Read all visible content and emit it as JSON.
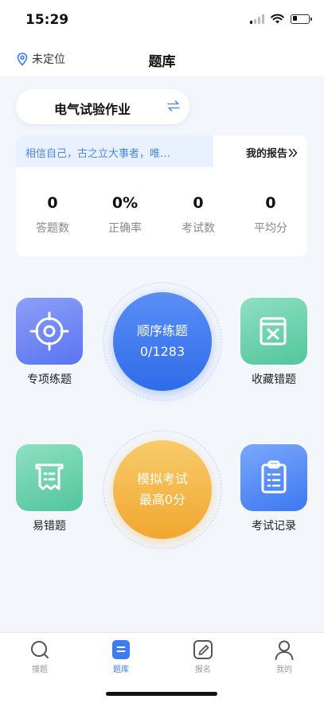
{
  "status_bar": {
    "time": "15:29",
    "battery_level": 0.3
  },
  "nav": {
    "location": "未定位",
    "title": "题库"
  },
  "subject": {
    "name": "电气试验作业",
    "switch_icon": "swap-arrows-icon"
  },
  "stats_card": {
    "motto": "相信自己，古之立大事者，唯…",
    "report_label": "我的报告",
    "report_icon": "double-chevron-right-icon",
    "stats": [
      {
        "value": "0",
        "label": "答题数"
      },
      {
        "value": "0%",
        "label": "正确率"
      },
      {
        "value": "0",
        "label": "考试数"
      },
      {
        "value": "0",
        "label": "平均分"
      }
    ]
  },
  "features": {
    "special_practice": {
      "label": "专项练题",
      "icon": "crosshair-icon"
    },
    "favorites_mistakes": {
      "label": "收藏错题",
      "icon": "close-box-icon"
    },
    "error_prone": {
      "label": "易错题",
      "icon": "scroll-list-icon"
    },
    "exam_records": {
      "label": "考试记录",
      "icon": "clipboard-icon"
    },
    "sequential": {
      "line1": "顺序练题",
      "line2": "0/1283"
    },
    "mock_exam": {
      "line1": "模拟考试",
      "line2": "最高0分"
    }
  },
  "tabs": [
    {
      "label": "搜题",
      "icon": "search-icon",
      "active": false
    },
    {
      "label": "题库",
      "icon": "question-bank-icon",
      "active": true
    },
    {
      "label": "报名",
      "icon": "edit-note-icon",
      "active": false
    },
    {
      "label": "我的",
      "icon": "user-icon",
      "active": false
    }
  ],
  "colors": {
    "accent": "#3b7cf0",
    "background": "#f3f6fb",
    "motto_text": "#4a86e8",
    "orange": "#f1a72f",
    "teal": "#52c59d"
  }
}
